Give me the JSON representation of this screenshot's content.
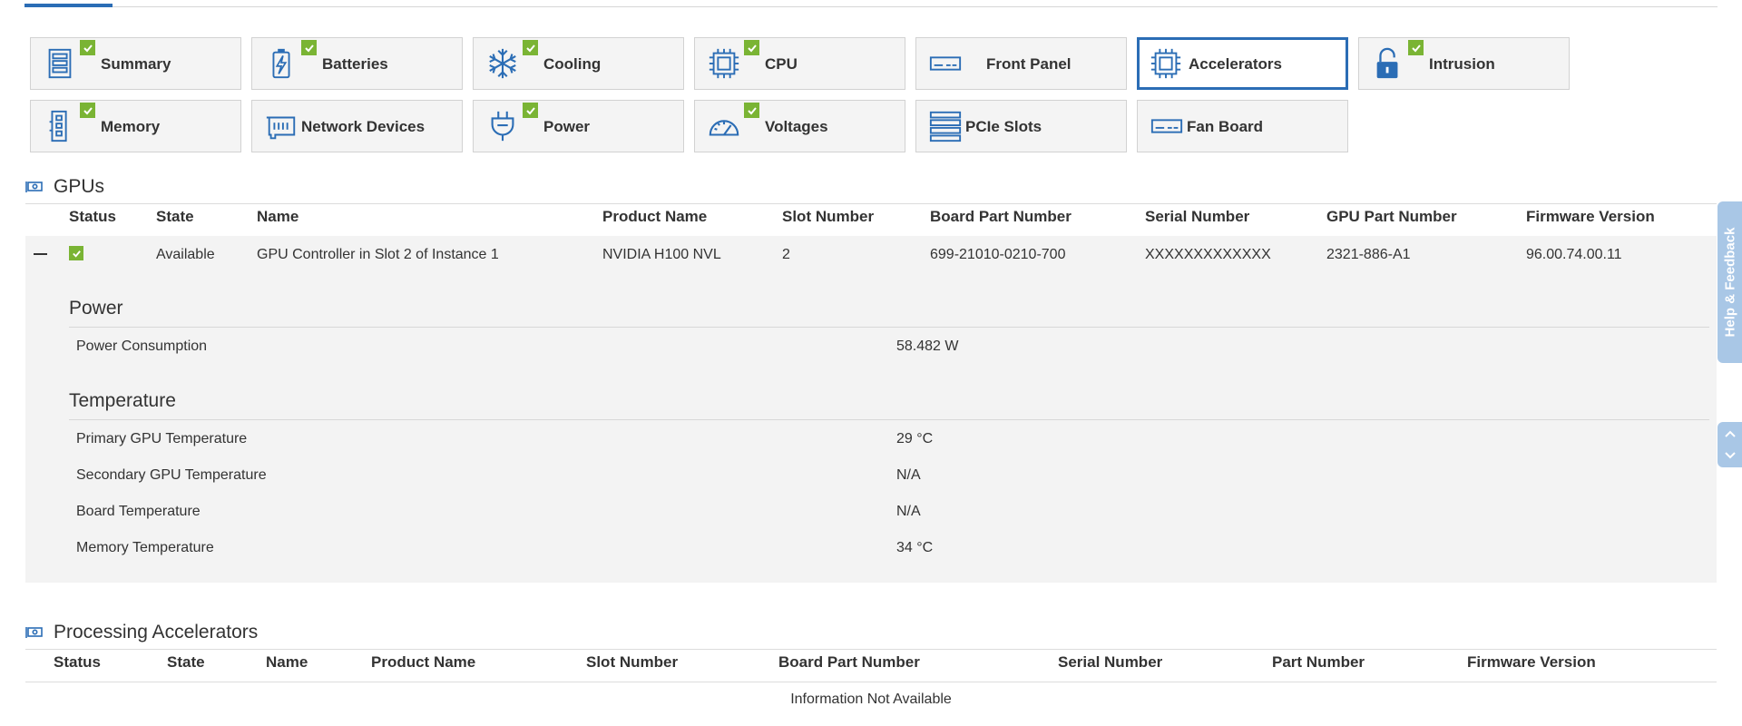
{
  "tiles": [
    {
      "label": "Summary",
      "icon": "summary-icon",
      "checked": true
    },
    {
      "label": "Batteries",
      "icon": "battery-icon",
      "checked": true
    },
    {
      "label": "Cooling",
      "icon": "snowflake-icon",
      "checked": true
    },
    {
      "label": "CPU",
      "icon": "cpu-icon",
      "checked": true
    },
    {
      "label": "Front Panel",
      "icon": "front-panel-icon",
      "checked": false
    },
    {
      "label": "Accelerators",
      "icon": "accelerator-icon",
      "checked": false,
      "active": true
    },
    {
      "label": "Intrusion",
      "icon": "lock-open-icon",
      "checked": true
    },
    {
      "label": "Memory",
      "icon": "memory-icon",
      "checked": true
    },
    {
      "label": "Network Devices",
      "icon": "network-card-icon",
      "checked": false
    },
    {
      "label": "Power",
      "icon": "plug-icon",
      "checked": true
    },
    {
      "label": "Voltages",
      "icon": "gauge-icon",
      "checked": true
    },
    {
      "label": "PCIe Slots",
      "icon": "pcie-slots-icon",
      "checked": false
    },
    {
      "label": "Fan Board",
      "icon": "fan-board-icon",
      "checked": false
    }
  ],
  "gpus": {
    "title": "GPUs",
    "columns": [
      "Status",
      "State",
      "Name",
      "Product Name",
      "Slot Number",
      "Board Part Number",
      "Serial Number",
      "GPU Part Number",
      "Firmware Version"
    ],
    "row": {
      "state": "Available",
      "name": "GPU Controller in Slot 2 of Instance 1",
      "product_name": "NVIDIA H100 NVL",
      "slot_number": "2",
      "board_part_number": "699-21010-0210-700",
      "serial_number": "XXXXXXXXXXXXX",
      "gpu_part_number": "2321-886-A1",
      "firmware_version": "96.00.74.00.11"
    },
    "power": {
      "title": "Power",
      "items": [
        {
          "label": "Power Consumption",
          "value": "58.482 W"
        }
      ]
    },
    "temperature": {
      "title": "Temperature",
      "items": [
        {
          "label": "Primary GPU Temperature",
          "value": "29 °C"
        },
        {
          "label": "Secondary GPU Temperature",
          "value": "N/A"
        },
        {
          "label": "Board Temperature",
          "value": "N/A"
        },
        {
          "label": "Memory Temperature",
          "value": "34 °C"
        }
      ]
    }
  },
  "processing_accelerators": {
    "title": "Processing Accelerators",
    "columns": [
      "Status",
      "State",
      "Name",
      "Product Name",
      "Slot Number",
      "Board Part Number",
      "Serial Number",
      "Part Number",
      "Firmware Version"
    ],
    "empty_text": "Information Not Available"
  },
  "feedback_label": "Help & Feedback",
  "colors": {
    "accent": "#2b6db5",
    "ok": "#7ab434",
    "feedback": "#a9c7e6"
  }
}
